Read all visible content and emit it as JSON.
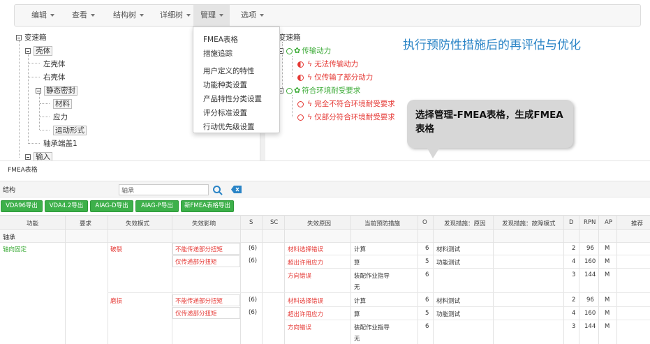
{
  "menu": [
    "编辑",
    "查看",
    "结构树",
    "详细树",
    "管理",
    "选项"
  ],
  "dropdown": [
    "FMEA表格",
    "措施追踪",
    "用户定义的特性",
    "功能种类设置",
    "产品特性分类设置",
    "评分标准设置",
    "行动优先级设置"
  ],
  "left_tree": {
    "root": "变速箱",
    "n1": "壳体",
    "n1a": "左壳体",
    "n1b": "右壳体",
    "n1c": "静态密封",
    "n1c1": "材料",
    "n1c2": "应力",
    "n1c3": "运动形式",
    "n2": "轴承端盖1",
    "n3": "输入"
  },
  "right_tree": {
    "root": "变速箱",
    "f1": "传输动力",
    "e1": "无法传输动力",
    "e2": "仅传输了部分动力",
    "f2": "符合环境耐受要求",
    "e3": "完全不符合环境耐受要求",
    "e4": "仅部分符合环境耐受要求"
  },
  "headline": "执行预防性措施后的再评估与优化",
  "callout": "选择管理-FMEA表格，生成FMEA表格",
  "lower": {
    "title": "FMEA表格",
    "struct_label": "结构",
    "struct_value": "轴承",
    "buttons": [
      "VDA96导出",
      "VDA4.2导出",
      "AIAG-D导出",
      "AIAG-P导出",
      "新FMEA表格导出"
    ],
    "headers": [
      "功能",
      "要求",
      "失效模式",
      "失效影响",
      "S",
      "SC",
      "失效原因",
      "当前预防措施",
      "O",
      "发现措施：原因",
      "发现措施：故障模式",
      "D",
      "RPN",
      "AP",
      "推荐"
    ],
    "group": "轴承",
    "function": "轴向固定",
    "blocks": [
      {
        "mode": "破裂",
        "effects": [
          {
            "text": "不能传递部分扭矩",
            "s": "(6)"
          },
          {
            "text": "仅传递部分扭矩",
            "s": "(6)"
          }
        ],
        "causes": [
          {
            "cause": "材料选择错误",
            "prev": "计算",
            "o": "6",
            "det": "材料测试",
            "d": "2",
            "rpn": "96",
            "ap": "M"
          },
          {
            "cause": "超出许用应力",
            "prev": "算",
            "o": "5",
            "det": "功能测试",
            "d": "4",
            "rpn": "160",
            "ap": "M"
          },
          {
            "cause": "方向错误",
            "prev": "装配作业指导",
            "prev2": "无",
            "o": "6",
            "det": "",
            "d": "3",
            "rpn": "144",
            "ap": "M"
          }
        ]
      },
      {
        "mode": "磨损",
        "effects": [
          {
            "text": "不能传递部分扭矩",
            "s": "(6)"
          },
          {
            "text": "仅传递部分扭矩",
            "s": "(6)"
          }
        ],
        "causes": [
          {
            "cause": "材料选择错误",
            "prev": "计算",
            "o": "6",
            "det": "材料测试",
            "d": "2",
            "rpn": "96",
            "ap": "M"
          },
          {
            "cause": "超出许用应力",
            "prev": "算",
            "o": "5",
            "det": "功能测试",
            "d": "4",
            "rpn": "160",
            "ap": "M"
          },
          {
            "cause": "方向错误",
            "prev": "装配作业指导",
            "prev2": "无",
            "o": "6",
            "det": "",
            "d": "3",
            "rpn": "144",
            "ap": "M"
          }
        ]
      }
    ]
  },
  "colors": {
    "green": "#3aaa35",
    "red": "#e53935",
    "blue": "#2a84c6",
    "button_green": "#3db04a"
  }
}
